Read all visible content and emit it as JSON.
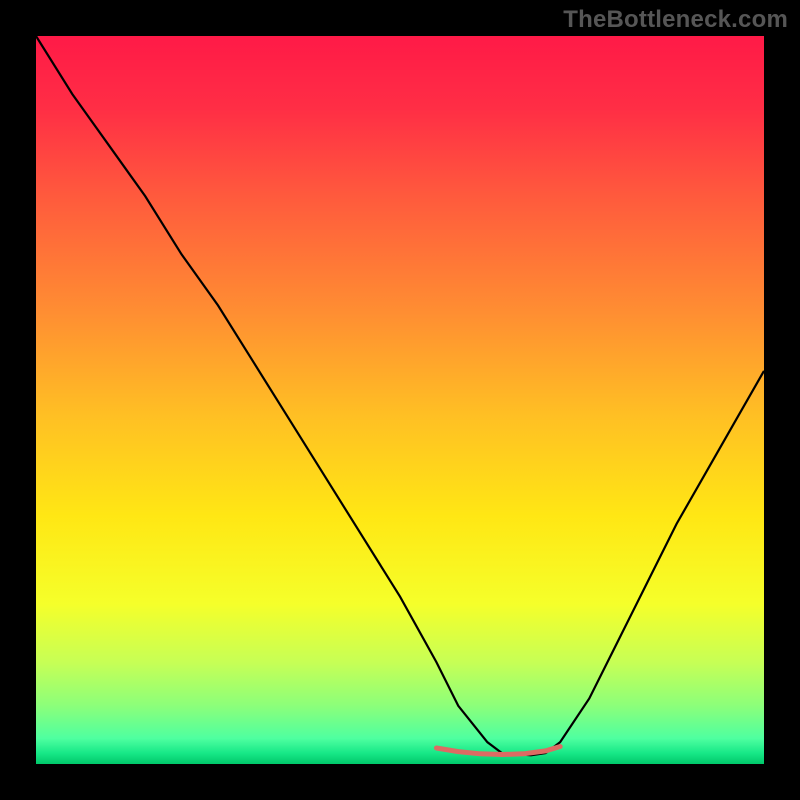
{
  "watermark": {
    "text": "TheBottleneck.com"
  },
  "chart_data": {
    "type": "line",
    "title": "",
    "xlabel": "",
    "ylabel": "",
    "xlim": [
      0,
      100
    ],
    "ylim": [
      0,
      100
    ],
    "grid": false,
    "legend": false,
    "gradient_stops": [
      {
        "offset": 0.0,
        "color": "#ff1a47"
      },
      {
        "offset": 0.1,
        "color": "#ff2e45"
      },
      {
        "offset": 0.22,
        "color": "#ff5a3d"
      },
      {
        "offset": 0.38,
        "color": "#ff8e32"
      },
      {
        "offset": 0.52,
        "color": "#ffbf24"
      },
      {
        "offset": 0.66,
        "color": "#ffe714"
      },
      {
        "offset": 0.78,
        "color": "#f5ff2a"
      },
      {
        "offset": 0.86,
        "color": "#c7ff55"
      },
      {
        "offset": 0.92,
        "color": "#8cff7a"
      },
      {
        "offset": 0.965,
        "color": "#4effa0"
      },
      {
        "offset": 0.985,
        "color": "#17e887"
      },
      {
        "offset": 1.0,
        "color": "#00c86a"
      }
    ],
    "series": [
      {
        "name": "curve",
        "stroke": "#000000",
        "stroke_width": 2.2,
        "x": [
          0,
          5,
          10,
          15,
          20,
          25,
          30,
          35,
          40,
          45,
          50,
          55,
          58,
          62,
          64,
          68,
          70,
          72,
          76,
          80,
          84,
          88,
          92,
          96,
          100
        ],
        "y": [
          100,
          92,
          85,
          78,
          70,
          63,
          55,
          47,
          39,
          31,
          23,
          14,
          8,
          3,
          1.5,
          1.2,
          1.5,
          3,
          9,
          17,
          25,
          33,
          40,
          47,
          54
        ]
      },
      {
        "name": "bottom-highlight",
        "stroke": "#dc6b63",
        "stroke_width": 5,
        "x": [
          55,
          58,
          61,
          64,
          67,
          70,
          72
        ],
        "y": [
          2.2,
          1.7,
          1.4,
          1.3,
          1.4,
          1.8,
          2.4
        ]
      }
    ]
  }
}
